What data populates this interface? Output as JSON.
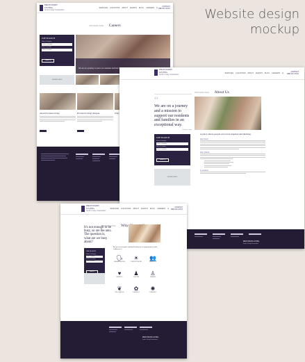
{
  "caption": {
    "line1": "Website design",
    "line2": "mockup"
  },
  "brand": {
    "name_line1": "PROVISION",
    "name_line2": "LIVING",
    "tagline": "Senior Living Communities"
  },
  "nav": [
    "SERVICES",
    "LOCATIONS",
    "ABOUT",
    "EVENTS",
    "BLOG",
    "CAREERS",
    "Q"
  ],
  "contact": {
    "label": "CONTACT",
    "phone": "888-XXX-XXXX"
  },
  "page1": {
    "breadcrumb": "PROVISION LIVING",
    "title": "Careers",
    "job_search": {
      "title": "JOB SEARCH",
      "fields": [
        {
          "label": "Select Category",
          "value": "Select Category"
        },
        {
          "label": "Select Location",
          "value": "Select Location"
        }
      ],
      "button": "SEARCH"
    },
    "grey_button": "CAREER FAIRS",
    "hero_caption": "We are on a journey to serve our residents and their families",
    "articles": [
      {
        "title": "About Provision Living",
        "more": "READ MORE"
      },
      {
        "title": "Provision Living's Purpose",
        "more": "READ MORE"
      },
      {
        "title": "Why Choose Us",
        "more": "READ MORE"
      }
    ]
  },
  "page2": {
    "breadcrumb": "PROVISION LIVING",
    "title": "About Us",
    "quote": "We are on a journey and a mission to support our residents and families in an exceptional way.",
    "quote_author": "Provision Living",
    "heading": "A place where people are loved, inspired and thriving.",
    "story_title": "Our Story",
    "values_title": "Our Values",
    "locations_title": "Locations",
    "job_search": {
      "title": "JOB SEARCH",
      "fields": [
        {
          "label": "Select Category",
          "value": "Select Category"
        },
        {
          "label": "Select Location",
          "value": "Select Location"
        }
      ],
      "button": "SEARCH"
    },
    "grey_button": "CAREER FAIRS"
  },
  "page3": {
    "breadcrumb": "PROVISION LIVING",
    "title": "Why Choose Us",
    "quote": "It's not enough to be busy, so are the ants. The question is, what are we busy about?",
    "intro": "Are you an energetic individual looking for an opportunity to make a difference?",
    "job_search": {
      "title": "JOB SEARCH",
      "fields": [
        {
          "label": "Select Category",
          "value": "Select Category"
        },
        {
          "label": "Select Location",
          "value": "Select Location"
        }
      ],
      "button": "SEARCH"
    },
    "benefits": [
      {
        "label": "CAREER GROWTH",
        "icon": "🗣"
      },
      {
        "label": "COMPETITIVE PAY",
        "icon": "☀"
      },
      {
        "label": "TEAMWORK",
        "icon": "👥"
      },
      {
        "label": "BENEFITS",
        "icon": "♥"
      },
      {
        "label": "CULTURE",
        "icon": "♟"
      },
      {
        "label": "TRAINING",
        "icon": "♙"
      },
      {
        "label": "RECOGNITION",
        "icon": "❦"
      },
      {
        "label": "FLEXIBILITY",
        "icon": "✿"
      },
      {
        "label": "COMMUNITY",
        "icon": "✺"
      }
    ]
  },
  "colors": {
    "brand_dark": "#2a2240",
    "footer": "#231c34",
    "lavender": "#6a4f9a",
    "background": "#ece5df"
  },
  "footer_brand": {
    "name": "PROVISION LIVING",
    "tagline": "Senior Living Communities"
  }
}
